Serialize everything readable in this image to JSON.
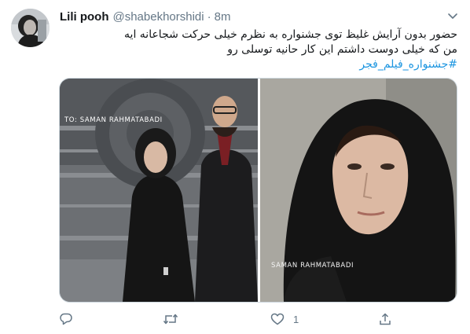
{
  "tweet": {
    "display_name": "Lili pooh",
    "handle": "@shabekhorshidi",
    "separator": "·",
    "time": "8m",
    "text_lines": [
      "حضور بدون آرایش غلیظ توی جشنواره به نظرم خیلی حرکت شجاعانه ایه",
      "من که خیلی دوست داشتم این کار حانیه توسلی رو"
    ],
    "hashtag": "#جشنواره_فیلم_فجر",
    "hashtag_color": "#1b95e0"
  },
  "media": {
    "left_watermark": "TO: SAMAN RAHMATABADI",
    "right_watermark": "SAMAN RAHMATABADI"
  },
  "actions": {
    "reply_icon": "reply-icon",
    "retweet_icon": "retweet-icon",
    "like_icon": "heart-icon",
    "like_count": "1",
    "share_icon": "share-icon"
  },
  "colors": {
    "secondary_text": "#657786",
    "border": "#ccd6dd"
  }
}
